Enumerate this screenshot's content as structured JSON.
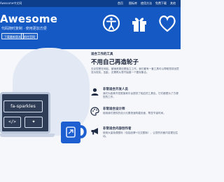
{
  "nav": {
    "brand": "Awesome中文网",
    "items": [
      "首页",
      "图标库",
      "使用方法",
      "免费下载",
      "其他"
    ]
  },
  "hero": {
    "title": "Awesome",
    "subtitle": "代码随时复制 · 使用更加方便",
    "buttons": [
      "下载最新版本",
      "前往官网"
    ]
  },
  "section": {
    "kicker": "适合工作的工具",
    "title": "不用自己再造轮子",
    "description": "无论您是在网站、营销资源还是独立工作，我们都有一套工具可以帮助您将创意变为现实。因此，无需再从零开始做一个图标集合。"
  },
  "features": [
    {
      "icon": "user-icon",
      "title": "非常适合开发人员",
      "description": "我们为各种开发框架和平台提供了相应的工具包，它们都是为了方便您的工作。"
    },
    {
      "icon": "palette-icon",
      "title": "非常适合设计师",
      "description": "使用我们提供的设计元素快速构建页面，帮您节省时间。"
    },
    {
      "icon": "megaphone-icon",
      "title": "非常适合内容创作者",
      "description": "使用大量免费图标（包括品牌+社交图标），让您的页面内容更加生动。"
    }
  ],
  "illustration": {
    "chip_label": "fa-sparkles",
    "code_glyph": "</>",
    "spark_glyph": "✦"
  },
  "colors": {
    "nav": "#0c3e8c",
    "hero": "#1459c4",
    "accent": "#1d5fd0"
  }
}
